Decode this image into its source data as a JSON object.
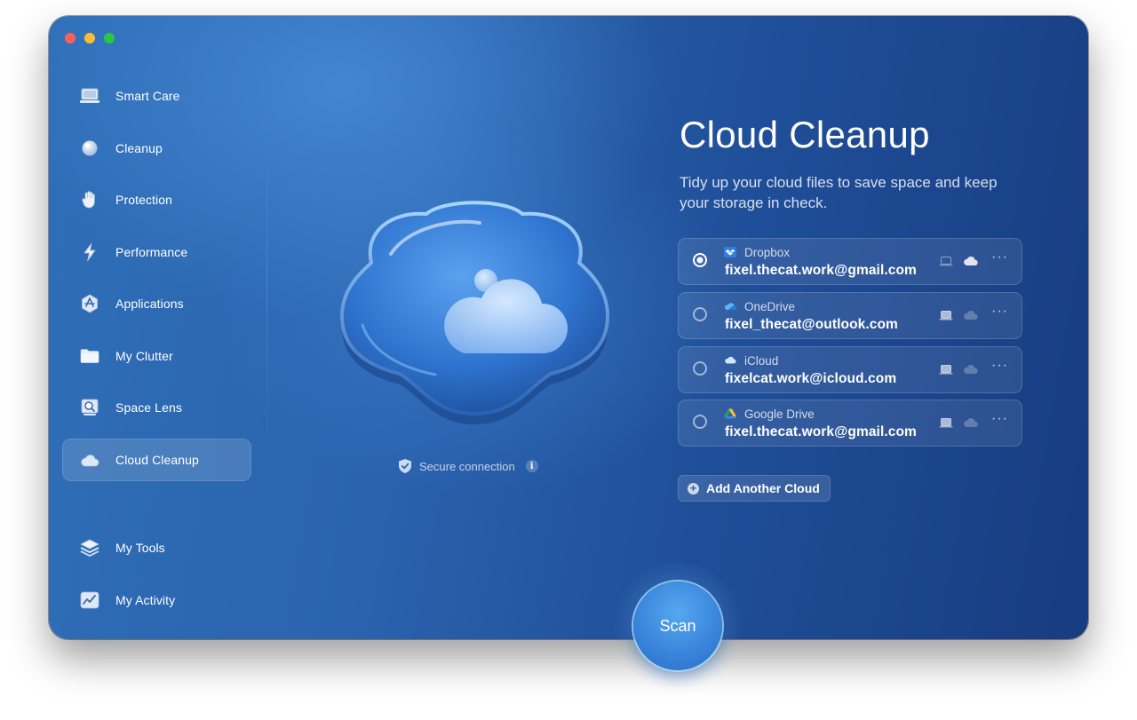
{
  "sidebar": {
    "items": [
      {
        "label": "Smart Care",
        "icon": "display-icon"
      },
      {
        "label": "Cleanup",
        "icon": "bubble-icon"
      },
      {
        "label": "Protection",
        "icon": "hand-icon"
      },
      {
        "label": "Performance",
        "icon": "bolt-icon"
      },
      {
        "label": "Applications",
        "icon": "app-store-icon"
      },
      {
        "label": "My Clutter",
        "icon": "folder-icon"
      },
      {
        "label": "Space Lens",
        "icon": "lens-icon"
      },
      {
        "label": "Cloud Cleanup",
        "icon": "cloud-icon",
        "active": true
      }
    ],
    "bottom_items": [
      {
        "label": "My Tools",
        "icon": "layers-icon"
      },
      {
        "label": "My Activity",
        "icon": "activity-icon"
      }
    ]
  },
  "hero": {
    "secure_label": "Secure connection",
    "info_glyph": "i"
  },
  "main": {
    "title": "Cloud Cleanup",
    "subtitle": "Tidy up your cloud files to save space and keep your storage in check."
  },
  "clouds": [
    {
      "provider": "Dropbox",
      "email": "fixel.thecat.work@gmail.com",
      "selected": true,
      "icon": "dropbox-icon"
    },
    {
      "provider": "OneDrive",
      "email": "fixel_thecat@outlook.com",
      "selected": false,
      "icon": "onedrive-icon"
    },
    {
      "provider": "iCloud",
      "email": "fixelcat.work@icloud.com",
      "selected": false,
      "icon": "icloud-icon"
    },
    {
      "provider": "Google Drive",
      "email": "fixel.thecat.work@gmail.com",
      "selected": false,
      "icon": "google-drive-icon"
    }
  ],
  "row_more_glyph": "···",
  "add_cloud_label": "Add Another Cloud",
  "scan_label": "Scan",
  "colors": {
    "accent_glow": "#7cc8ff",
    "window_dark": "#173c80",
    "window_light": "#2f6fb8"
  }
}
